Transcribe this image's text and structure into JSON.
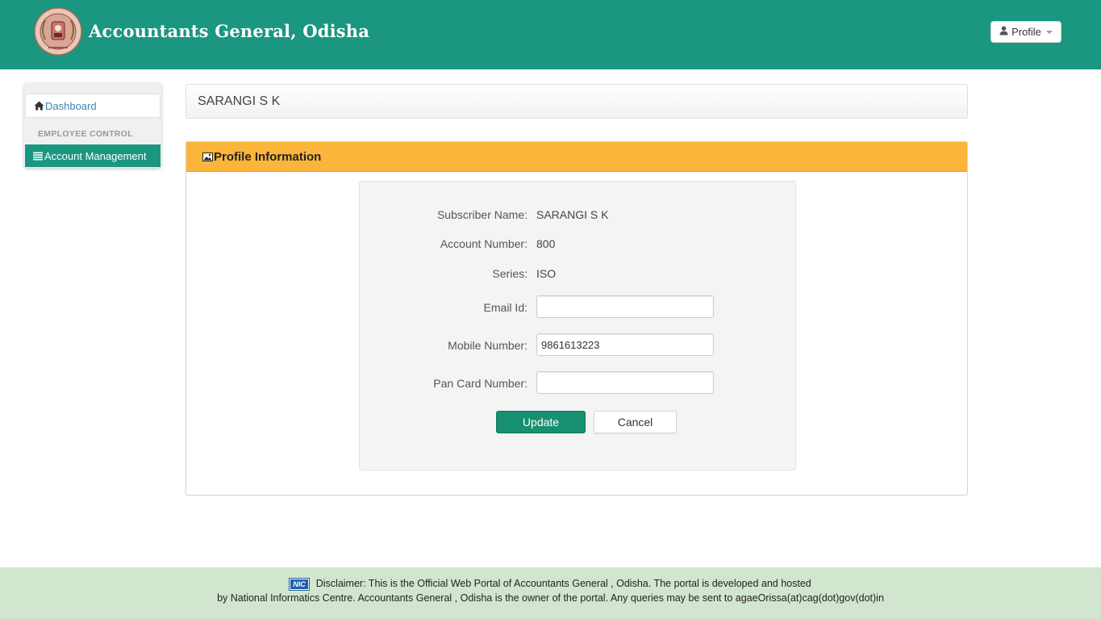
{
  "header": {
    "site_title": "Accountants General, Odisha",
    "profile_button": "Profile",
    "brand_color": "#1b9680"
  },
  "sidebar": {
    "dashboard_label": "Dashboard",
    "section_header": "EMPLOYEE CONTROL",
    "account_management_label": "Account Management"
  },
  "user_bar": {
    "name": "SARANGI S K"
  },
  "panel": {
    "title": "Profile Information",
    "accent_color": "#fbb53a",
    "rows": [
      {
        "label": "Subscriber Name:",
        "value": "SARANGI S K"
      },
      {
        "label": "Account Number:",
        "value": "800"
      },
      {
        "label": "Series:",
        "value": "ISO"
      }
    ],
    "fields": [
      {
        "label": "Email Id:",
        "value": ""
      },
      {
        "label": "Mobile Number:",
        "value": "9861613223"
      },
      {
        "label": "Pan Card Number:",
        "value": ""
      }
    ],
    "update_button": "Update",
    "cancel_button": "Cancel"
  },
  "footer": {
    "badge": "NIC",
    "line1": "Disclaimer: This is the Official Web Portal of Accountants General , Odisha. The portal is developed and hosted",
    "line2": "by National Informatics Centre. Accountants General , Odisha is the owner of the portal. Any queries may be sent to agaeOrissa(at)cag(dot)gov(dot)in"
  }
}
